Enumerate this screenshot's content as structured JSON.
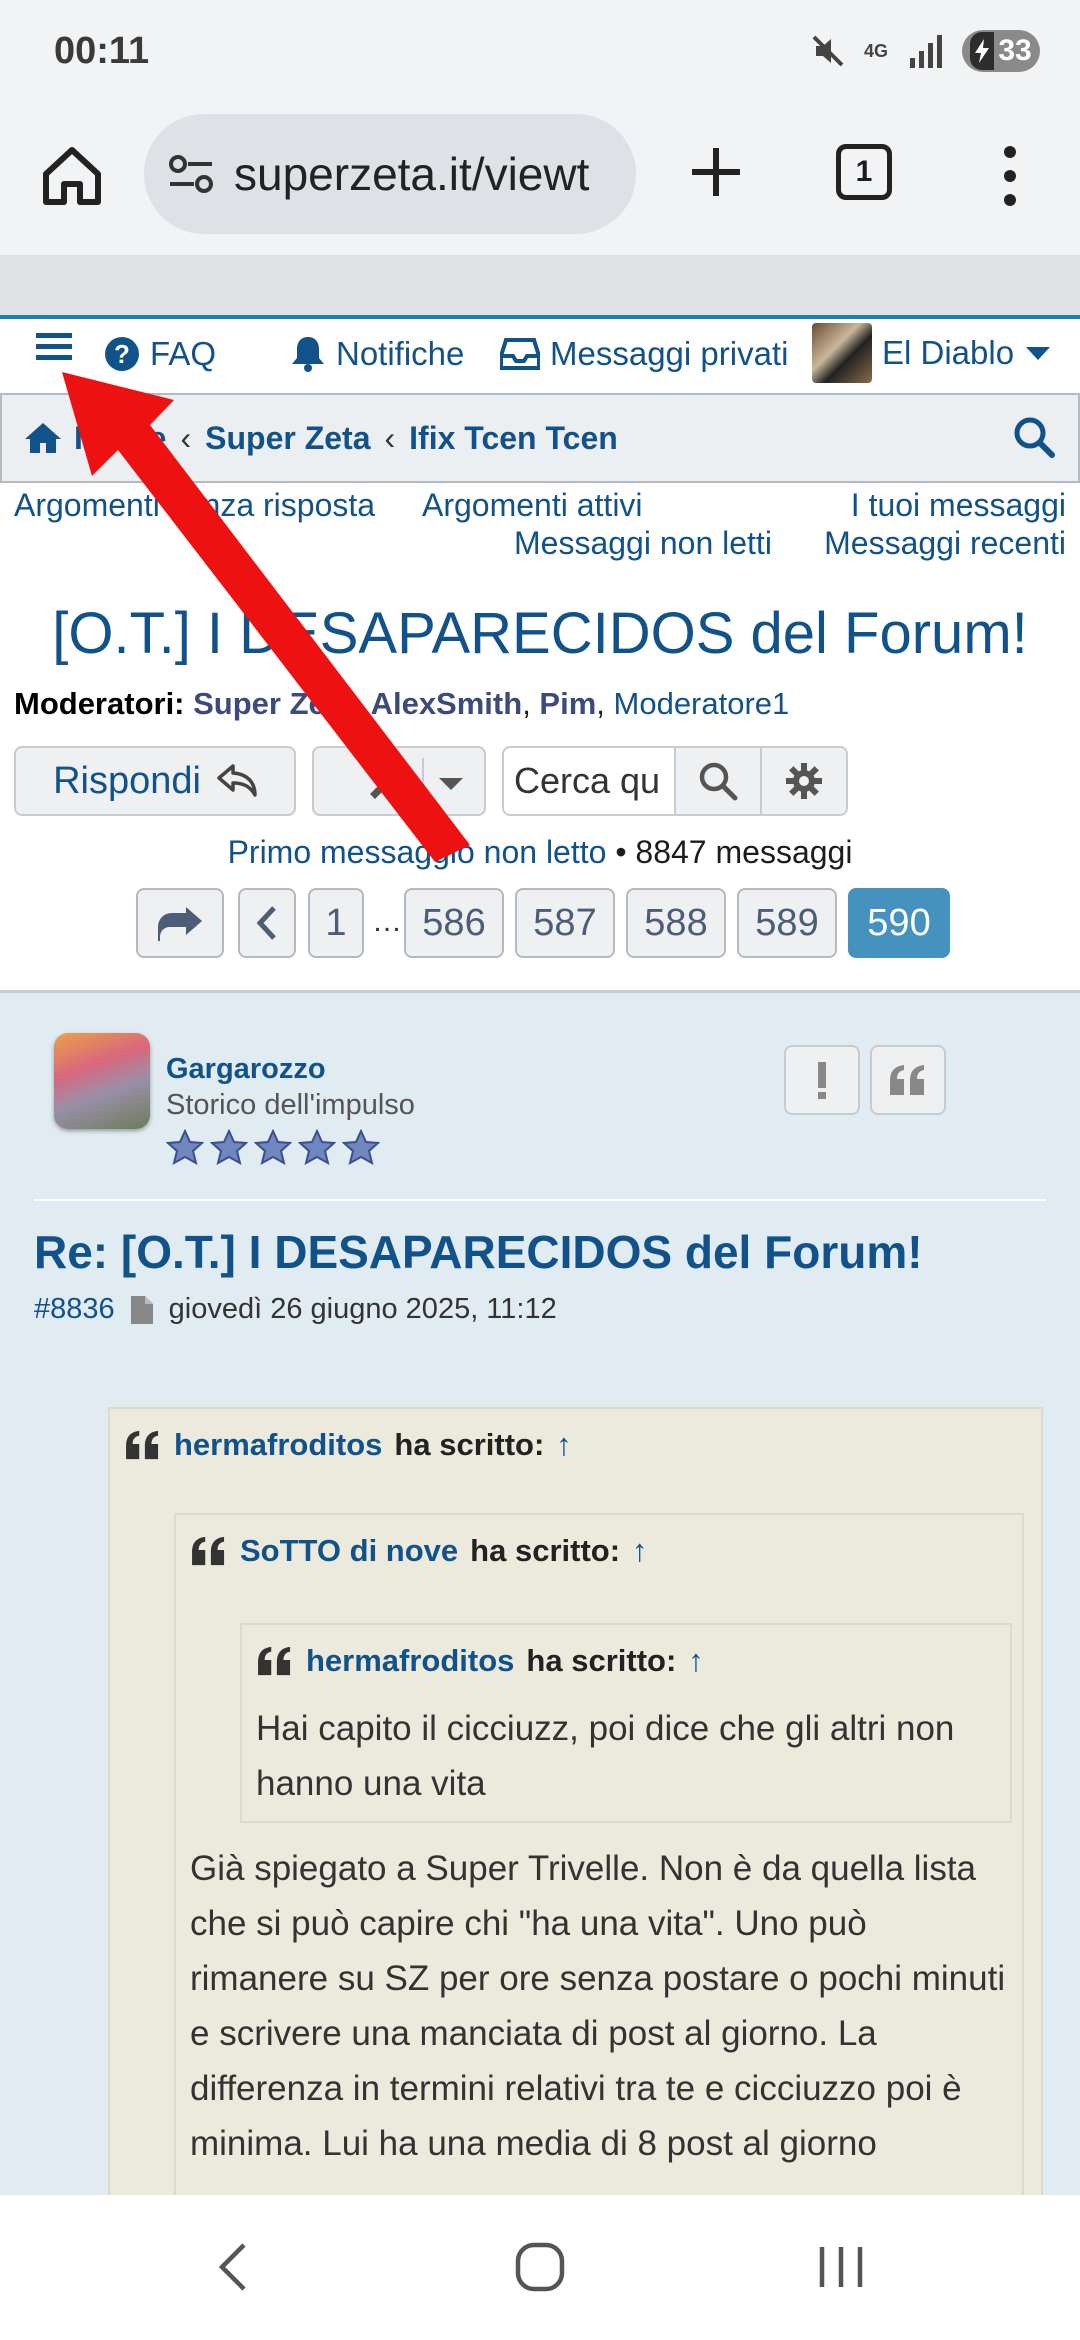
{
  "status": {
    "time": "00:11",
    "network": "4G",
    "battery": "33"
  },
  "browser": {
    "url": "superzeta.it/viewt",
    "tab_count": "1"
  },
  "topnav": {
    "faq": "FAQ",
    "notifications": "Notifiche",
    "private_messages": "Messaggi privati",
    "user": "El Diablo"
  },
  "breadcrumbs": [
    "Indice",
    "Super Zeta",
    "Ifix Tcen Tcen"
  ],
  "quicklinks": {
    "unanswered": "Argomenti senza risposta",
    "active": "Argomenti attivi",
    "your_posts": "I tuoi messaggi",
    "unread": "Messaggi non letti",
    "recent": "Messaggi recenti"
  },
  "topic": {
    "title": "[O.T.] I DESAPARECIDOS del Forum!",
    "moderators_label": "Moderatori:",
    "moderators": [
      "Super Zeta",
      "AlexSmith",
      "Pim",
      "Moderatore1"
    ]
  },
  "actions": {
    "reply": "Rispondi",
    "search_placeholder": "Cerca qu"
  },
  "pageinfo": {
    "first_unread": "Primo messaggio non letto",
    "count": "8847 messaggi"
  },
  "pagination": [
    "1",
    "586",
    "587",
    "588",
    "589",
    "590"
  ],
  "pagination_ellipsis": "…",
  "post": {
    "author": "Gargarozzo",
    "rank": "Storico dell'impulso",
    "stars": 5,
    "title": "Re: [O.T.] I DESAPARECIDOS del Forum!",
    "number": "#8836",
    "date": "giovedì 26 giugno 2025, 11:12",
    "quote1_author": "hermafroditos",
    "quote2_author": "SoTTO di nove",
    "quote3_author": "hermafroditos",
    "wrote": "ha scritto:",
    "up_arrow": "↑",
    "quote3_text": "Hai capito il cicciuzz, poi dice che gli altri non hanno una vita",
    "quote2_text": "Già spiegato a Super Trivelle. Non è da quella lista che si può capire chi \"ha una vita\". Uno può rimanere su SZ per ore senza postare o pochi minuti e scrivere una manciata di post al giorno. La differenza in termini relativi tra te e cicciuzzo poi è minima. Lui ha una media di 8 post al giorno"
  },
  "colors": {
    "link": "#105289",
    "accent": "#4692bf",
    "post_bg": "#e1ebf2",
    "quote_bg": "#ebeadd",
    "annotation": "#ee1111"
  }
}
